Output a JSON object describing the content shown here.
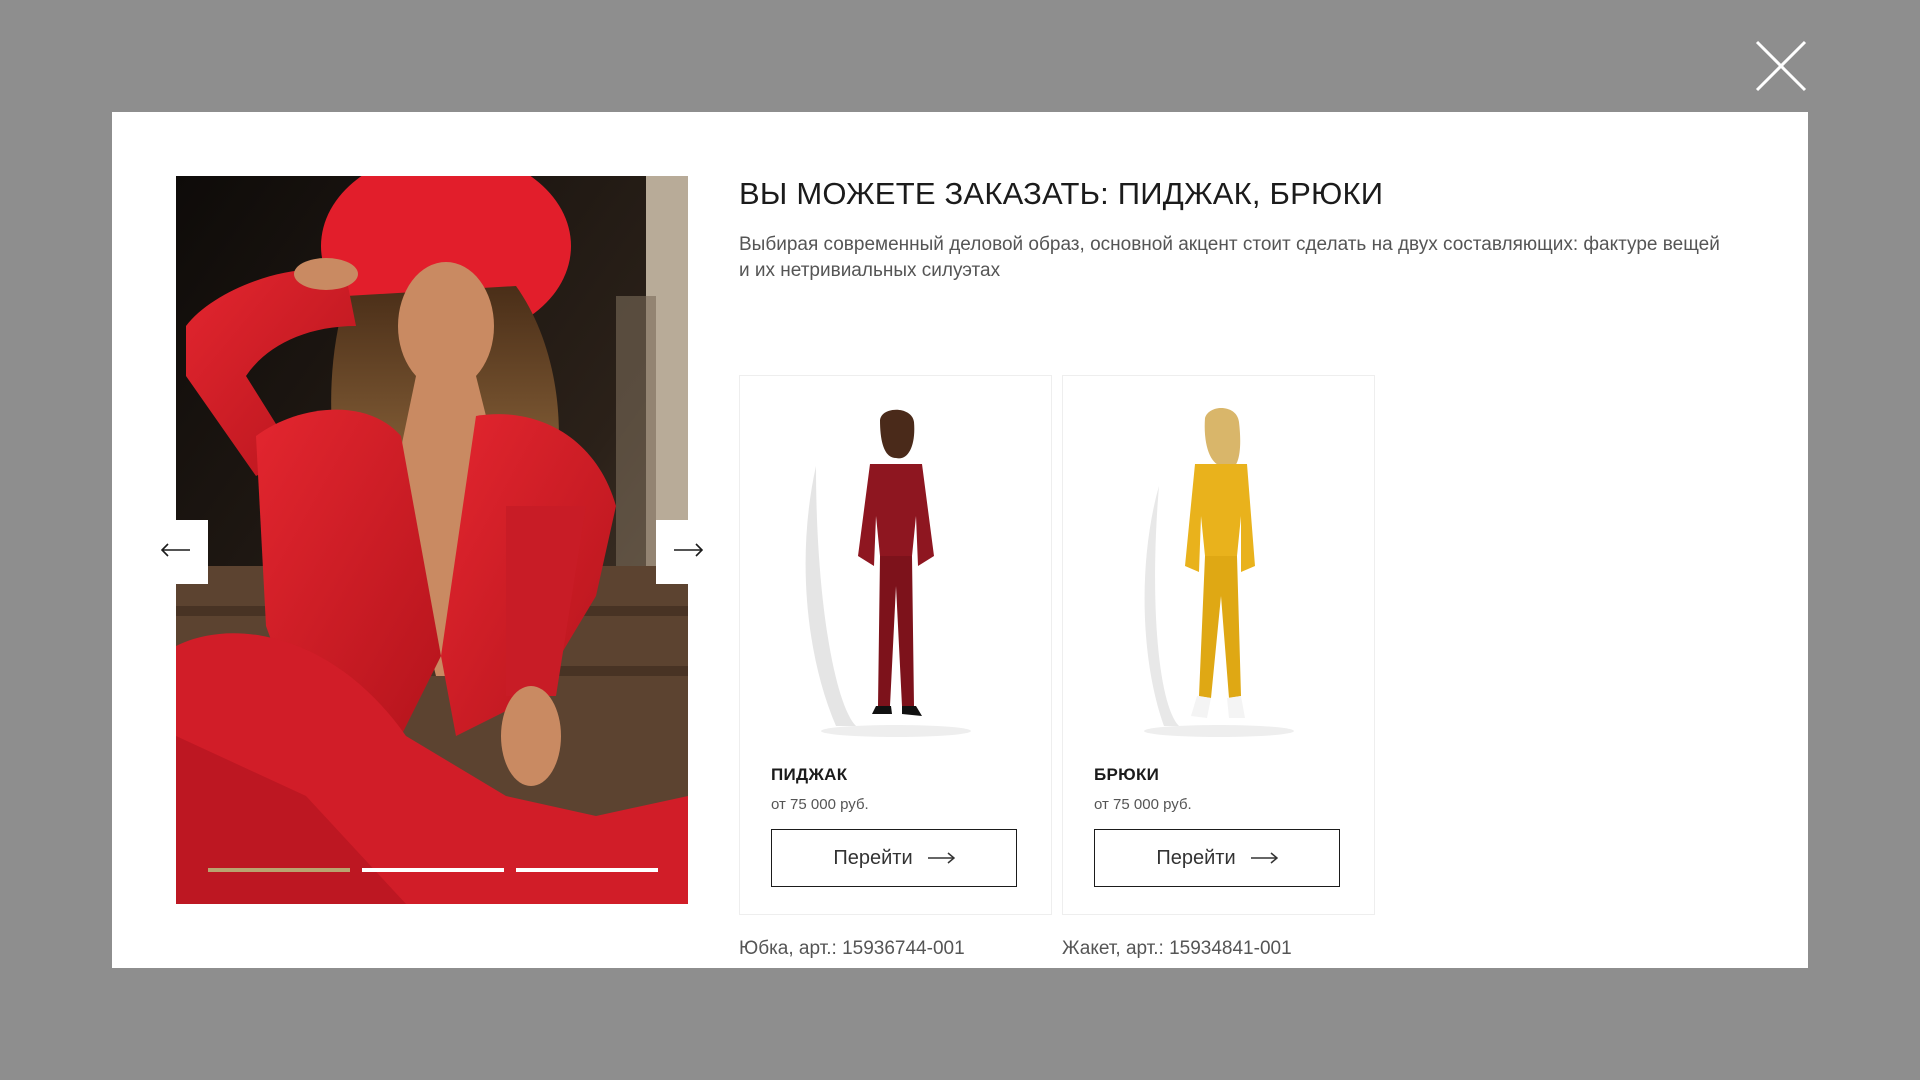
{
  "modal": {
    "title": "ВЫ МОЖЕТЕ ЗАКАЗАТЬ: ПИДЖАК, БРЮКИ",
    "description": "Выбирая современный деловой образ, основной акцент стоит сделать на двух составляющих: фактуре вещей и их нетривиальных силуэтах"
  },
  "gallery": {
    "prev_icon": "arrow-left-icon",
    "next_icon": "arrow-right-icon",
    "slides_count": 3,
    "active_slide": 1
  },
  "products": [
    {
      "name": "ПИДЖАК",
      "price": "от 75 000 руб.",
      "button_label": "Перейти",
      "color": "#8e1620"
    },
    {
      "name": "БРЮКИ",
      "price": "от 75 000 руб.",
      "button_label": "Перейти",
      "color": "#e9b21c"
    }
  ],
  "articles": [
    "Юбка, арт.: 15936744-001",
    "Жакет, арт.: 15934841-001"
  ],
  "colors": {
    "overlay": "#8e8e8e",
    "accent_gold": "#b9a46f",
    "hero_red": "#d5202a"
  }
}
